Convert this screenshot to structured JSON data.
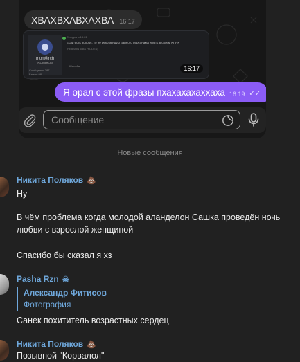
{
  "colors": {
    "background": "#212121",
    "accent_name": "#6fa8dc",
    "outgoing_bubble": "#8b5cf6",
    "divider_text": "#8a8a8a"
  },
  "screenshot": {
    "incoming_message": {
      "text": "ХВАХВХАВХАХВА",
      "time": "16:17"
    },
    "photo_message": {
      "time": "16:17",
      "user_name": "mon@rch",
      "user_status": "Бывалый",
      "stats_line1": "Сообщения     387",
      "stats_line2": "Баллы            98",
      "post_meta": "Сегодня в 13:22",
      "post_text": "Если есть вопрос, то не рекомендую данного персонажа иметь в своем КПНК",
      "post_report": "[REASON WAS HIDDEN]",
      "post_footer": "Жалоба"
    },
    "outgoing_message": {
      "text": "Я орал с этой фразы пхахахахаххаха",
      "time": "16:19",
      "status_icon": "double-check-icon"
    },
    "composer": {
      "placeholder": "Сообщение",
      "attach_icon": "paperclip-icon",
      "emoji_icon": "sticker-icon",
      "voice_icon": "microphone-icon"
    }
  },
  "divider": "Новые сообщения",
  "messages": [
    {
      "sender": "Никита Поляков",
      "badge_icon": "poop-emoji-icon",
      "lines": [
        "Ну",
        "В чём проблема когда молодой аланделон Сашка проведён ночь любви с взрослой женщиной",
        "Спасибо бы сказал я хз"
      ]
    },
    {
      "sender": "Pasha Rzn",
      "badge_icon": "skull-emoji-icon",
      "reply": {
        "name": "Александр Фитисов",
        "text": "Фотография"
      },
      "lines": [
        "Санек похититель возрастных сердец"
      ]
    },
    {
      "sender": "Никита Поляков",
      "badge_icon": "poop-emoji-icon",
      "lines": [
        "Позывной \"Корвалол\""
      ]
    }
  ]
}
